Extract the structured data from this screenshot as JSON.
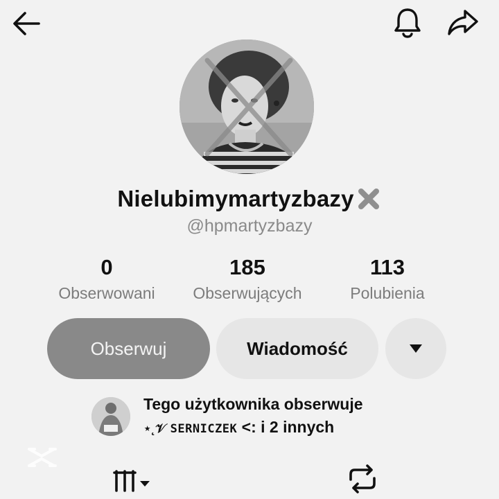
{
  "header": {
    "back_icon": "arrow-left-icon",
    "notify_icon": "bell-icon",
    "share_icon": "share-arrow-icon"
  },
  "profile": {
    "display_name": "Nielubimymartyzbazy",
    "display_name_emoji": "cross-mark-icon",
    "handle": "@hpmartyzbazy"
  },
  "stats": [
    {
      "value": "0",
      "label": "Obserwowani"
    },
    {
      "value": "185",
      "label": "Obserwujących"
    },
    {
      "value": "113",
      "label": "Polubienia"
    }
  ],
  "actions": {
    "follow_label": "Obserwuj",
    "message_label": "Wiadomość",
    "more_icon": "caret-down-icon"
  },
  "followed_by": {
    "line1": "Tego użytkownika obserwuje",
    "decoration": "⋆˛𝒱",
    "username": "SERNICZEK",
    "suffix": "<: i 2 innych"
  },
  "tabs": {
    "grid_icon": "grid-columns-icon",
    "repost_icon": "repost-icon"
  },
  "colors": {
    "background": "#f2f2f2",
    "follow_button": "#898989",
    "secondary_button": "#e6e6e6",
    "muted_text": "#7c7c7c"
  }
}
